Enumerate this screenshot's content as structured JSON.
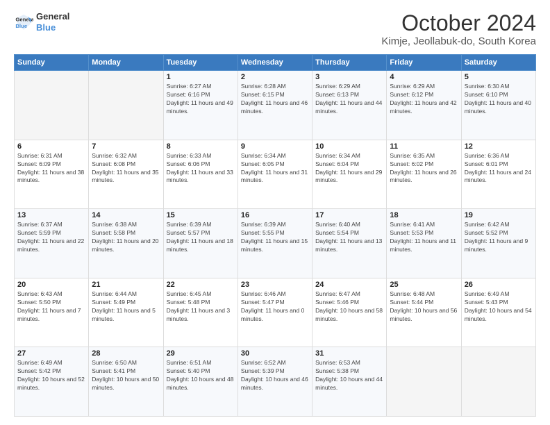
{
  "logo": {
    "line1": "General",
    "line2": "Blue"
  },
  "header": {
    "month": "October 2024",
    "location": "Kimje, Jeollabuk-do, South Korea"
  },
  "weekdays": [
    "Sunday",
    "Monday",
    "Tuesday",
    "Wednesday",
    "Thursday",
    "Friday",
    "Saturday"
  ],
  "weeks": [
    [
      {
        "day": "",
        "sunrise": "",
        "sunset": "",
        "daylight": ""
      },
      {
        "day": "",
        "sunrise": "",
        "sunset": "",
        "daylight": ""
      },
      {
        "day": "1",
        "sunrise": "Sunrise: 6:27 AM",
        "sunset": "Sunset: 6:16 PM",
        "daylight": "Daylight: 11 hours and 49 minutes."
      },
      {
        "day": "2",
        "sunrise": "Sunrise: 6:28 AM",
        "sunset": "Sunset: 6:15 PM",
        "daylight": "Daylight: 11 hours and 46 minutes."
      },
      {
        "day": "3",
        "sunrise": "Sunrise: 6:29 AM",
        "sunset": "Sunset: 6:13 PM",
        "daylight": "Daylight: 11 hours and 44 minutes."
      },
      {
        "day": "4",
        "sunrise": "Sunrise: 6:29 AM",
        "sunset": "Sunset: 6:12 PM",
        "daylight": "Daylight: 11 hours and 42 minutes."
      },
      {
        "day": "5",
        "sunrise": "Sunrise: 6:30 AM",
        "sunset": "Sunset: 6:10 PM",
        "daylight": "Daylight: 11 hours and 40 minutes."
      }
    ],
    [
      {
        "day": "6",
        "sunrise": "Sunrise: 6:31 AM",
        "sunset": "Sunset: 6:09 PM",
        "daylight": "Daylight: 11 hours and 38 minutes."
      },
      {
        "day": "7",
        "sunrise": "Sunrise: 6:32 AM",
        "sunset": "Sunset: 6:08 PM",
        "daylight": "Daylight: 11 hours and 35 minutes."
      },
      {
        "day": "8",
        "sunrise": "Sunrise: 6:33 AM",
        "sunset": "Sunset: 6:06 PM",
        "daylight": "Daylight: 11 hours and 33 minutes."
      },
      {
        "day": "9",
        "sunrise": "Sunrise: 6:34 AM",
        "sunset": "Sunset: 6:05 PM",
        "daylight": "Daylight: 11 hours and 31 minutes."
      },
      {
        "day": "10",
        "sunrise": "Sunrise: 6:34 AM",
        "sunset": "Sunset: 6:04 PM",
        "daylight": "Daylight: 11 hours and 29 minutes."
      },
      {
        "day": "11",
        "sunrise": "Sunrise: 6:35 AM",
        "sunset": "Sunset: 6:02 PM",
        "daylight": "Daylight: 11 hours and 26 minutes."
      },
      {
        "day": "12",
        "sunrise": "Sunrise: 6:36 AM",
        "sunset": "Sunset: 6:01 PM",
        "daylight": "Daylight: 11 hours and 24 minutes."
      }
    ],
    [
      {
        "day": "13",
        "sunrise": "Sunrise: 6:37 AM",
        "sunset": "Sunset: 5:59 PM",
        "daylight": "Daylight: 11 hours and 22 minutes."
      },
      {
        "day": "14",
        "sunrise": "Sunrise: 6:38 AM",
        "sunset": "Sunset: 5:58 PM",
        "daylight": "Daylight: 11 hours and 20 minutes."
      },
      {
        "day": "15",
        "sunrise": "Sunrise: 6:39 AM",
        "sunset": "Sunset: 5:57 PM",
        "daylight": "Daylight: 11 hours and 18 minutes."
      },
      {
        "day": "16",
        "sunrise": "Sunrise: 6:39 AM",
        "sunset": "Sunset: 5:55 PM",
        "daylight": "Daylight: 11 hours and 15 minutes."
      },
      {
        "day": "17",
        "sunrise": "Sunrise: 6:40 AM",
        "sunset": "Sunset: 5:54 PM",
        "daylight": "Daylight: 11 hours and 13 minutes."
      },
      {
        "day": "18",
        "sunrise": "Sunrise: 6:41 AM",
        "sunset": "Sunset: 5:53 PM",
        "daylight": "Daylight: 11 hours and 11 minutes."
      },
      {
        "day": "19",
        "sunrise": "Sunrise: 6:42 AM",
        "sunset": "Sunset: 5:52 PM",
        "daylight": "Daylight: 11 hours and 9 minutes."
      }
    ],
    [
      {
        "day": "20",
        "sunrise": "Sunrise: 6:43 AM",
        "sunset": "Sunset: 5:50 PM",
        "daylight": "Daylight: 11 hours and 7 minutes."
      },
      {
        "day": "21",
        "sunrise": "Sunrise: 6:44 AM",
        "sunset": "Sunset: 5:49 PM",
        "daylight": "Daylight: 11 hours and 5 minutes."
      },
      {
        "day": "22",
        "sunrise": "Sunrise: 6:45 AM",
        "sunset": "Sunset: 5:48 PM",
        "daylight": "Daylight: 11 hours and 3 minutes."
      },
      {
        "day": "23",
        "sunrise": "Sunrise: 6:46 AM",
        "sunset": "Sunset: 5:47 PM",
        "daylight": "Daylight: 11 hours and 0 minutes."
      },
      {
        "day": "24",
        "sunrise": "Sunrise: 6:47 AM",
        "sunset": "Sunset: 5:46 PM",
        "daylight": "Daylight: 10 hours and 58 minutes."
      },
      {
        "day": "25",
        "sunrise": "Sunrise: 6:48 AM",
        "sunset": "Sunset: 5:44 PM",
        "daylight": "Daylight: 10 hours and 56 minutes."
      },
      {
        "day": "26",
        "sunrise": "Sunrise: 6:49 AM",
        "sunset": "Sunset: 5:43 PM",
        "daylight": "Daylight: 10 hours and 54 minutes."
      }
    ],
    [
      {
        "day": "27",
        "sunrise": "Sunrise: 6:49 AM",
        "sunset": "Sunset: 5:42 PM",
        "daylight": "Daylight: 10 hours and 52 minutes."
      },
      {
        "day": "28",
        "sunrise": "Sunrise: 6:50 AM",
        "sunset": "Sunset: 5:41 PM",
        "daylight": "Daylight: 10 hours and 50 minutes."
      },
      {
        "day": "29",
        "sunrise": "Sunrise: 6:51 AM",
        "sunset": "Sunset: 5:40 PM",
        "daylight": "Daylight: 10 hours and 48 minutes."
      },
      {
        "day": "30",
        "sunrise": "Sunrise: 6:52 AM",
        "sunset": "Sunset: 5:39 PM",
        "daylight": "Daylight: 10 hours and 46 minutes."
      },
      {
        "day": "31",
        "sunrise": "Sunrise: 6:53 AM",
        "sunset": "Sunset: 5:38 PM",
        "daylight": "Daylight: 10 hours and 44 minutes."
      },
      {
        "day": "",
        "sunrise": "",
        "sunset": "",
        "daylight": ""
      },
      {
        "day": "",
        "sunrise": "",
        "sunset": "",
        "daylight": ""
      }
    ]
  ]
}
